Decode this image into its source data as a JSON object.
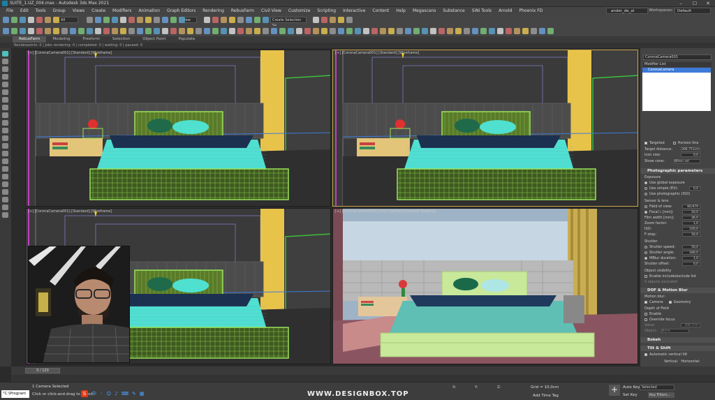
{
  "window": {
    "title": "SUITE_1.UZ_004.max - Autodesk 3ds Max 2021",
    "workspace_label": "Workspaces:",
    "workspace_value": "Default",
    "user": "ander_de_al"
  },
  "menus": [
    "File",
    "Edit",
    "Tools",
    "Group",
    "Views",
    "Create",
    "Modifiers",
    "Animation",
    "Graph Editors",
    "Rendering",
    "RebusFarm",
    "Civil View",
    "Customize",
    "Scripting",
    "Interactive",
    "Content",
    "Help",
    "Megascans",
    "Substance",
    "SiNi Tools",
    "Arnold",
    "Phoenix FD"
  ],
  "toolbar": {
    "selection_filter": "All",
    "view_dropdown": "View",
    "named_selection": "Create Selection Se"
  },
  "ribbon_tabs": [
    "RebusFarm",
    "Modeling",
    "Freeform",
    "Selection",
    "Object Paint",
    "Populate"
  ],
  "render_status": "Renderpoints: 0 | Jobs rendering: 0 | completed: 0 | waiting: 0 | paused: 0",
  "viewports": [
    {
      "label": "[+] [CoronaCamera001] [Standard] [Wireframe]"
    },
    {
      "label": "[+] [CoronaCamera001] [Standard] [Wireframe]"
    },
    {
      "label": "[+] [CoronaCamera001] [Standard] [Wireframe]"
    },
    {
      "label": "[+] [CoronaCamera001] [User Defined] [Default Shading]"
    }
  ],
  "command_panel": {
    "object_name": "CoronaCamera001",
    "modifier_list": "Modifier List",
    "stack_item": "CoronaCamera",
    "targeted": "Targeted",
    "horizon_line": "Horizon line",
    "target_distance_label": "Target distance:",
    "target_distance": "306,751cm",
    "icon_size_label": "Icon size:",
    "icon_size": "0,0",
    "show_cone_label": "Show cone:",
    "show_cone": "When sel",
    "photographic_header": "Photographic parameters",
    "exposure_label": "Exposure",
    "use_global": "Use global exposure",
    "use_simple": "Use simple (EV):",
    "use_simple_val": "0,0",
    "use_photographic": "Use photographic (ISO)",
    "sensor_label": "Sensor & lens",
    "field_of_view": "Field of view:",
    "field_of_view_val": "60,979",
    "focal": "Focal l. [mm]:",
    "focal_val": "20,0",
    "film_width": "Film width [mm]:",
    "film_width_val": "36,0",
    "zoom_factor": "Zoom factor:",
    "zoom_factor_val": "1,0",
    "iso": "ISO:",
    "iso_val": "100,0",
    "fstop": "F-stop:",
    "fstop_val": "16,0",
    "shutter_label": "Shutter",
    "shutter_speed": "Shutter speed:",
    "shutter_speed_val": "50,0",
    "shutter_angle": "Shutter angle:",
    "shutter_angle_val": "180,0",
    "mblur": "MBlur duration:",
    "mblur_val": "1,0",
    "shutter_offset": "Shutter offset:",
    "shutter_offset_val": "0,0",
    "visibility_label": "Object visibility",
    "include_exclude": "Enable include/exclude list",
    "objects_excluded": "0 objects excluded",
    "dof_header": "DOF & Motion Blur",
    "motion_blur_label": "Motion blur:",
    "camera": "Camera",
    "geometry": "Geometry",
    "depth_label": "Depth of Field",
    "enable": "Enable",
    "override_focus": "Override focus",
    "value_label": "Value:",
    "value_val": "306,7cm",
    "object_label": "Object:",
    "object_val": "None",
    "bokeh_header": "Bokeh",
    "tilt_header": "Tilt & Shift",
    "auto_vertical": "Automatic vertical tilt",
    "vertical": "Vertical:",
    "horizontal": "Horizontal:"
  },
  "timeline": {
    "frame": "0 / 120"
  },
  "status": {
    "selected": "1 Camera Selected",
    "prompt": "Click or click-and-drag to select",
    "grid": "Grid = 10,0cm",
    "add_time_tag": "Add Time Tag",
    "auto_key": "Auto Key",
    "set_key": "Set Key",
    "selected_dropdown": "Selected",
    "key_filters": "Key Filters...",
    "x_label": "X:",
    "y_label": "Y:",
    "z_label": "Z:",
    "maxscript": "\"C:\\Program"
  },
  "watermark": "WWW.DESIGNBOX.TOP",
  "colors": {
    "accent": "#c9a64a",
    "wire_green": "#9be35a",
    "cyan": "#4fe0d0",
    "yellow_curtain": "#e8c34a",
    "selection_blue": "#3d7bd9"
  }
}
